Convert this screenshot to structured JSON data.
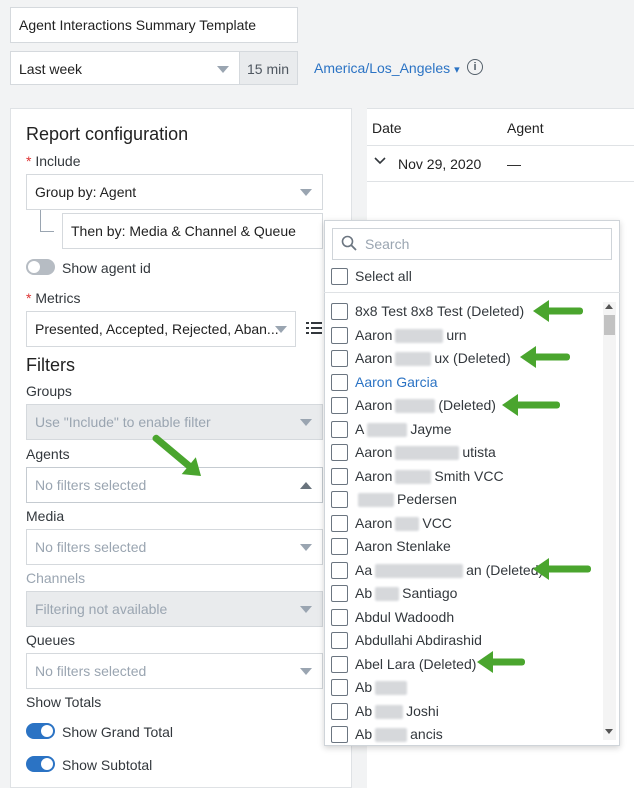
{
  "report_title": "Agent Interactions Summary Template",
  "date_range": "Last week",
  "interval": "15 min",
  "timezone": "America/Los_Angeles",
  "timezone_caret": "▾",
  "info_glyph": "i",
  "config": {
    "title": "Report configuration",
    "include_label": "Include",
    "group_by": "Group by: Agent",
    "then_by": "Then by: Media & Channel & Queue",
    "show_agent_id": "Show agent id",
    "metrics_label": "Metrics",
    "metrics_value": "Presented, Accepted, Rejected, Aban..."
  },
  "filters": {
    "title": "Filters",
    "groups_label": "Groups",
    "groups_value": "Use \"Include\" to enable filter",
    "agents_label": "Agents",
    "agents_value": "No filters selected",
    "media_label": "Media",
    "media_value": "No filters selected",
    "channels_label": "Channels",
    "channels_value": "Filtering not available",
    "queues_label": "Queues",
    "queues_value": "No filters selected"
  },
  "totals": {
    "label": "Show Totals",
    "grand_total": "Show Grand Total",
    "subtotal": "Show Subtotal"
  },
  "table": {
    "col_date": "Date",
    "col_agent": "Agent",
    "row_date": "Nov 29, 2020",
    "row_agent": "—"
  },
  "dropdown": {
    "search_placeholder": "Search",
    "select_all": "Select all",
    "items": [
      {
        "a": "8x8 Test 8x8 Test (Deleted)",
        "b": ""
      },
      {
        "a": "Aaron",
        "b": "urn"
      },
      {
        "a": "Aaron",
        "b": "ux (Deleted)"
      },
      {
        "a": "Aaron Garcia",
        "b": ""
      },
      {
        "a": "Aaron",
        "b": "(Deleted)"
      },
      {
        "a": "A",
        "b": "Jayme"
      },
      {
        "a": "Aaron",
        "b": "utista"
      },
      {
        "a": "Aaron",
        "b": "Smith VCC"
      },
      {
        "a": "",
        "b": "Pedersen"
      },
      {
        "a": "Aaron",
        "b": "VCC"
      },
      {
        "a": "Aaron Stenlake",
        "b": ""
      },
      {
        "a": "Aa",
        "b": "an (Deleted)"
      },
      {
        "a": "Ab",
        "b": "Santiago"
      },
      {
        "a": "Abdul Wadoodh",
        "b": ""
      },
      {
        "a": "Abdullahi Abdirashid",
        "b": ""
      },
      {
        "a": "Abel Lara (Deleted)",
        "b": ""
      },
      {
        "a": "Ab",
        "b": ""
      },
      {
        "a": "Ab",
        "b": "Joshi"
      },
      {
        "a": "Ab",
        "b": "ancis"
      }
    ]
  },
  "colors": {
    "accent": "#2b73c4",
    "annotation_arrow": "#4aa52e"
  }
}
